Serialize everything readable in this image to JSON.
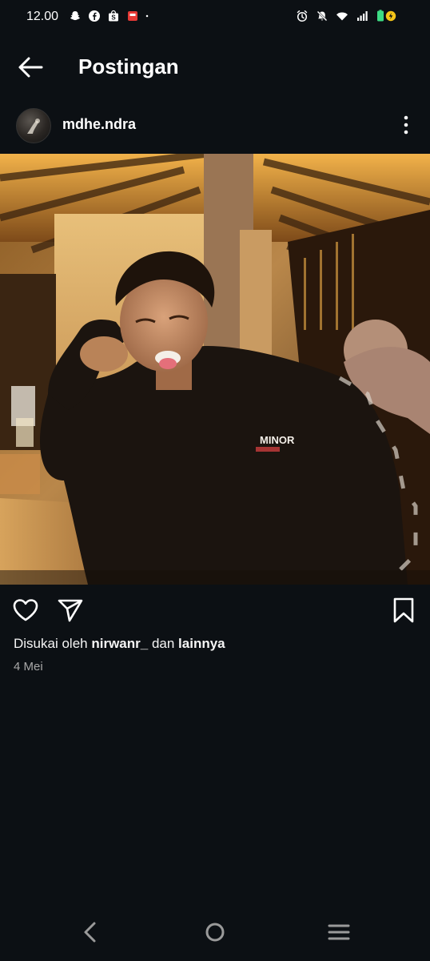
{
  "status_bar": {
    "time": "12.00",
    "left_icons": [
      "snapchat-icon",
      "facebook-icon",
      "shopee-icon",
      "shopeepay-icon",
      "dot-icon"
    ],
    "right_icons": [
      "alarm-icon",
      "mute-icon",
      "wifi-icon",
      "signal-icon",
      "battery-icon"
    ]
  },
  "header": {
    "title": "Postingan",
    "back_icon": "arrow-left-icon"
  },
  "post": {
    "username": "mdhe.ndra",
    "more_icon": "more-vertical-icon",
    "shirt_text": "MINOR",
    "liked_prefix": "Disukai oleh",
    "liked_user": "nirwanr_",
    "liked_conj": "dan",
    "liked_others": "lainnya",
    "date": "4 Mei"
  },
  "actions": {
    "like_icon": "heart-icon",
    "share_icon": "send-icon",
    "save_icon": "bookmark-icon"
  },
  "nav": {
    "back": "nav-back-icon",
    "home": "nav-home-icon",
    "recents": "nav-recents-icon"
  },
  "colors": {
    "background": "#0c1014",
    "text": "#f5f5f5",
    "muted": "#a8a8a8"
  }
}
